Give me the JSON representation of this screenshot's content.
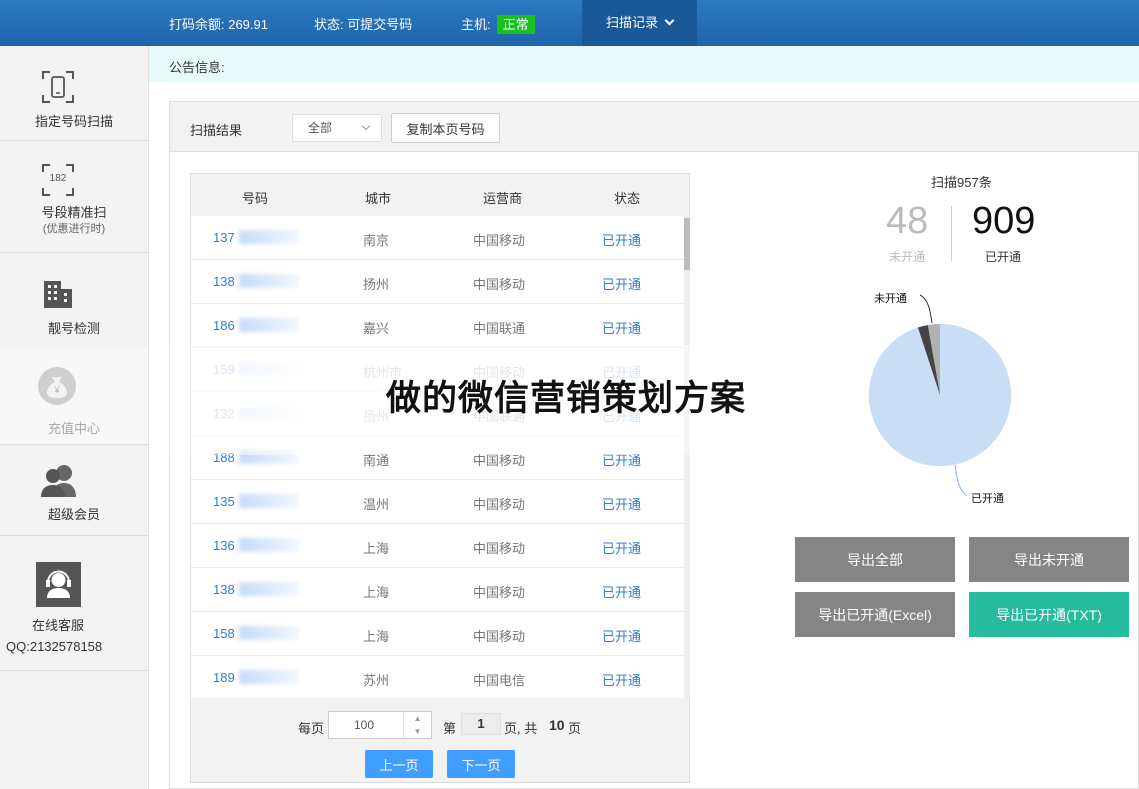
{
  "topbar": {
    "balance": "打码余额: 269.91",
    "status": "状态: 可提交号码",
    "host_label": "主机:",
    "host_status": "正常",
    "menu": "扫描记录"
  },
  "sidebar": {
    "items": [
      {
        "label": "指定号码扫描"
      },
      {
        "label": "号段精准扫",
        "sub": "(优惠进行时)",
        "icon_text": "182"
      },
      {
        "label": "靓号检测"
      },
      {
        "label": "充值中心",
        "icon_text": "¥"
      },
      {
        "label": "超级会员"
      },
      {
        "label": "在线客服",
        "sub": "QQ:2132578158"
      }
    ]
  },
  "notice": {
    "label": "公告信息:"
  },
  "panel": {
    "title": "扫描结果",
    "filter": "全部",
    "copy_button": "复制本页号码"
  },
  "table": {
    "columns": [
      "号码",
      "城市",
      "运营商",
      "状态"
    ],
    "rows": [
      {
        "num": "137",
        "city": "南京",
        "op": "中国移动",
        "status": "已开通"
      },
      {
        "num": "138",
        "city": "扬州",
        "op": "中国移动",
        "status": "已开通"
      },
      {
        "num": "186",
        "city": "嘉兴",
        "op": "中国联通",
        "status": "已开通"
      },
      {
        "num": "159",
        "city": "杭州市",
        "op": "中国移动",
        "status": "已开通"
      },
      {
        "num": "132",
        "city": "扬州",
        "op": "中国联通",
        "status": "已开通"
      },
      {
        "num": "188",
        "city": "南通",
        "op": "中国移动",
        "status": "已开通"
      },
      {
        "num": "135",
        "city": "温州",
        "op": "中国移动",
        "status": "已开通"
      },
      {
        "num": "136",
        "city": "上海",
        "op": "中国移动",
        "status": "已开通"
      },
      {
        "num": "138",
        "city": "上海",
        "op": "中国移动",
        "status": "已开通"
      },
      {
        "num": "158",
        "city": "上海",
        "op": "中国移动",
        "status": "已开通"
      },
      {
        "num": "189",
        "city": "苏州",
        "op": "中国电信",
        "status": "已开通"
      }
    ]
  },
  "pager": {
    "per_page_label": "每页",
    "per_page": "100",
    "page_prefix": "第",
    "page": "1",
    "page_suffix": "页, 共",
    "total_pages": "10",
    "total_suffix": "页",
    "prev": "上一页",
    "next": "下一页"
  },
  "stats": {
    "title": "扫描957条",
    "inactive_count": "48",
    "inactive_label": "未开通",
    "active_count": "909",
    "active_label": "已开通"
  },
  "chart_data": {
    "type": "pie",
    "slices": [
      {
        "label": "已开通",
        "value": 909,
        "color": "#c9def5"
      },
      {
        "label": "未开通",
        "value": 48,
        "color": "#b0b0b0"
      }
    ]
  },
  "export": {
    "all": "导出全部",
    "inactive": "导出未开通",
    "active_excel": "导出已开通(Excel)",
    "active_txt": "导出已开通(TXT)"
  },
  "watermark": "做的微信营销策划方案"
}
